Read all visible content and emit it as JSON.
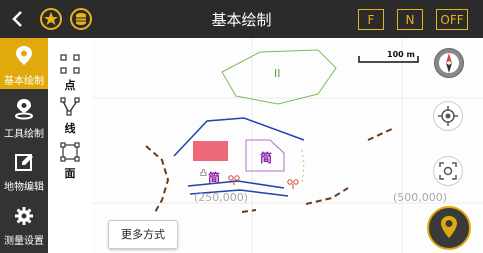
{
  "header": {
    "title": "基本绘制",
    "btn_f": "F",
    "btn_n": "N",
    "btn_off": "OFF"
  },
  "sidebar": {
    "items": [
      {
        "label": "基本绘制",
        "icon": "location-pin-icon"
      },
      {
        "label": "工具绘制",
        "icon": "tool-pin-icon"
      },
      {
        "label": "地物编辑",
        "icon": "edit-icon"
      },
      {
        "label": "测量设置",
        "icon": "gear-icon"
      }
    ]
  },
  "subbar": {
    "items": [
      {
        "label": "点",
        "icon": "point-icon"
      },
      {
        "label": "线",
        "icon": "line-icon"
      },
      {
        "label": "面",
        "icon": "polygon-icon"
      }
    ]
  },
  "map": {
    "scale_label": "100 m",
    "coord_left": "(250,000)",
    "coord_right": "(500,000)",
    "polygon_label": "II",
    "feature_label_1": "简",
    "feature_label_2": "简",
    "more_button": "更多方式"
  },
  "colors": {
    "accent": "#e1a90c",
    "topbar": "#2b2b2b",
    "sidebar": "#333333"
  }
}
